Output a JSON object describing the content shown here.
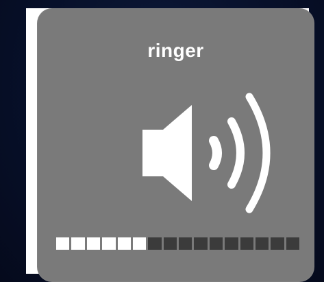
{
  "hud": {
    "title": "ringer",
    "icon": "speaker-high-volume-icon"
  },
  "volume": {
    "level": 6,
    "max": 16
  },
  "colors": {
    "hud_background": "#7a7a7a",
    "segment_on": "#ffffff",
    "segment_off": "#3b3b3b"
  }
}
